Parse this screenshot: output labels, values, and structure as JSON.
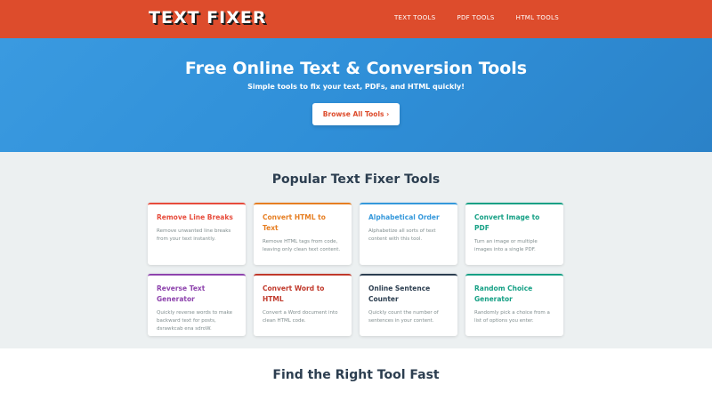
{
  "header": {
    "logo": "TEXT FIXER",
    "nav": [
      "TEXT TOOLS",
      "PDF TOOLS",
      "HTML TOOLS"
    ]
  },
  "hero": {
    "title": "Free Online Text & Conversion Tools",
    "subtitle": "Simple tools to fix your text, PDFs, and HTML quickly!",
    "button": "Browse All Tools ›"
  },
  "popular": {
    "title": "Popular Text Fixer Tools",
    "cards": [
      {
        "title": "Remove Line Breaks",
        "desc": "Remove unwanted line breaks from your text instantly.",
        "color": "#e74c3c"
      },
      {
        "title": "Convert HTML to Text",
        "desc": "Remove HTML tags from code, leaving only clean text content.",
        "color": "#e67e22"
      },
      {
        "title": "Alphabetical Order",
        "desc": "Alphabetize all sorts of text content with this tool.",
        "color": "#3498db"
      },
      {
        "title": "Convert Image to PDF",
        "desc": "Turn an image or multiple images into a single PDF.",
        "color": "#16a085"
      },
      {
        "title": "Reverse Text Generator",
        "desc": "Quickly reverse words to make backward text for posts, dsrawkcab ena sdroW.",
        "color": "#8e44ad"
      },
      {
        "title": "Convert Word to HTML",
        "desc": "Convert a Word document into clean HTML code.",
        "color": "#c0392b"
      },
      {
        "title": "Online Sentence Counter",
        "desc": "Quickly count the number of sentences in your content.",
        "color": "#2c3e50"
      },
      {
        "title": "Random Choice Generator",
        "desc": "Randomly pick a choice from a list of options you enter.",
        "color": "#16a085"
      }
    ]
  },
  "find": {
    "title": "Find the Right Tool Fast"
  }
}
